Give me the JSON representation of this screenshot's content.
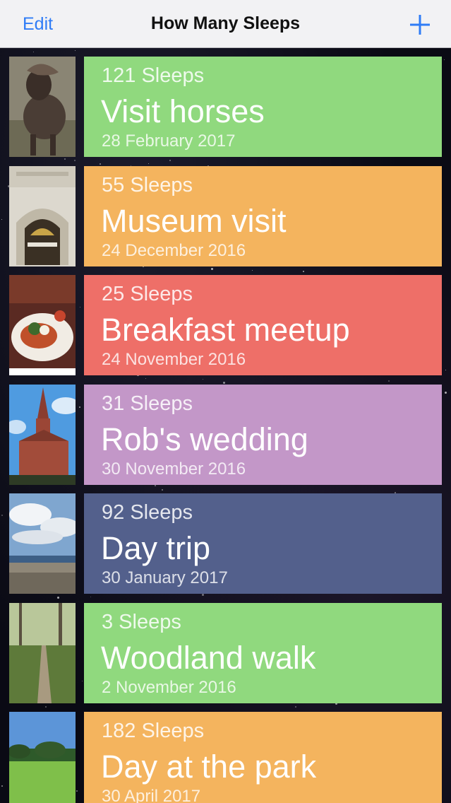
{
  "navbar": {
    "edit_label": "Edit",
    "title": "How Many Sleeps",
    "add_icon": "plus-icon",
    "accent_color": "#2f7cf6"
  },
  "events": [
    {
      "sleeps": "121 Sleeps",
      "title": "Visit horses",
      "date": "28 February 2017",
      "color": "#90d97e",
      "photo": "pony-photo"
    },
    {
      "sleeps": "55 Sleeps",
      "title": "Museum visit",
      "date": "24 December 2016",
      "color": "#f4b45e",
      "photo": "museum-entrance-photo"
    },
    {
      "sleeps": "25 Sleeps",
      "title": "Breakfast meetup",
      "date": "24 November 2016",
      "color": "#ee6f68",
      "photo": "breakfast-plate-photo"
    },
    {
      "sleeps": "31 Sleeps",
      "title": "Rob's wedding",
      "date": "30 November 2016",
      "color": "#c397c8",
      "photo": "church-photo"
    },
    {
      "sleeps": "92 Sleeps",
      "title": "Day trip",
      "date": "30 January 2017",
      "color": "#53608c",
      "photo": "beach-photo"
    },
    {
      "sleeps": "3 Sleeps",
      "title": "Woodland walk",
      "date": "2 November 2016",
      "color": "#90d97e",
      "photo": "woodland-path-photo"
    },
    {
      "sleeps": "182 Sleeps",
      "title": "Day at the park",
      "date": "30 April 2017",
      "color": "#f4b45e",
      "photo": "park-photo"
    }
  ]
}
